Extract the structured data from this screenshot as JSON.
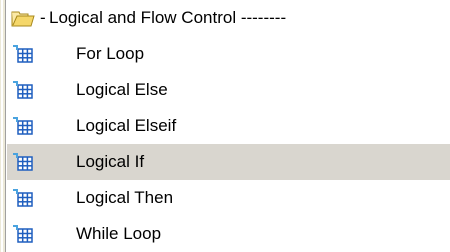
{
  "tree": {
    "folder": {
      "prefix": "-",
      "label": "Logical and Flow Control --------",
      "icon": "folder-open-icon"
    },
    "items": [
      {
        "label": "For Loop",
        "icon": "table-icon",
        "selected": false
      },
      {
        "label": "Logical Else",
        "icon": "table-icon",
        "selected": false
      },
      {
        "label": "Logical Elseif",
        "icon": "table-icon",
        "selected": false
      },
      {
        "label": "Logical If",
        "icon": "table-icon",
        "selected": true
      },
      {
        "label": "Logical Then",
        "icon": "table-icon",
        "selected": false
      },
      {
        "label": "While Loop",
        "icon": "table-icon",
        "selected": false
      }
    ]
  },
  "colors": {
    "selection": "#d9d6cf",
    "folder": "#f5d76a",
    "table_icon": "#1f5fbf"
  }
}
